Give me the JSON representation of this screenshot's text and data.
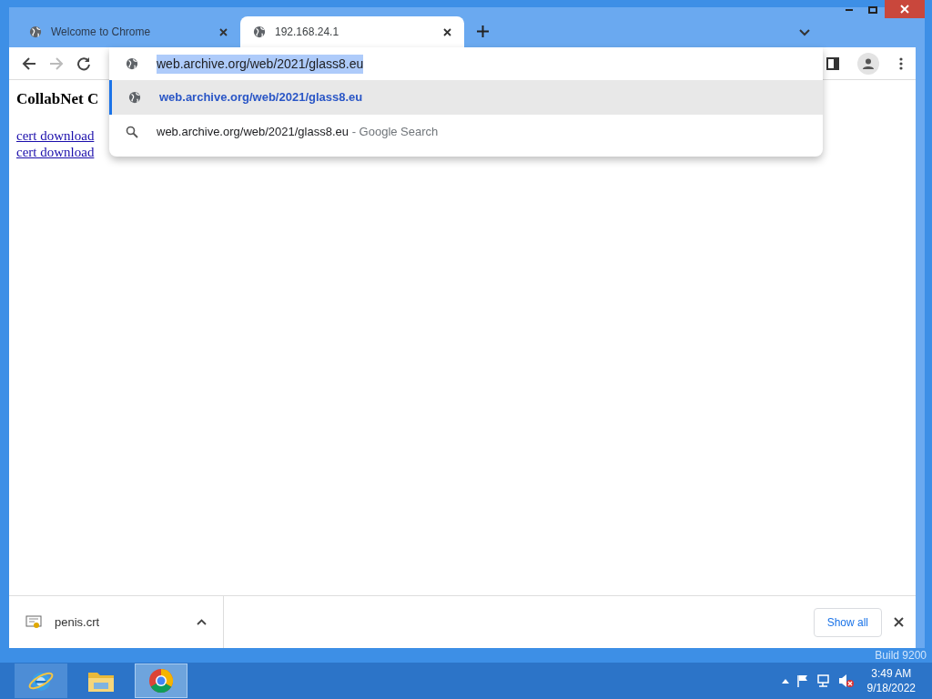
{
  "browser": {
    "tabs": [
      {
        "title": "Welcome to Chrome",
        "selected": false
      },
      {
        "title": "192.168.24.1",
        "selected": true
      }
    ],
    "omnibox": {
      "value": "web.archive.org/web/2021/glass8.eu",
      "highlighted": true
    },
    "suggestions": [
      {
        "kind": "url",
        "text": "web.archive.org/web/2021/glass8.eu",
        "selected": true
      },
      {
        "kind": "search",
        "text": "web.archive.org/web/2021/glass8.eu",
        "suffix": "- Google Search",
        "selected": false
      }
    ],
    "page": {
      "heading": "CollabNet C",
      "links": [
        "cert download",
        "cert download"
      ]
    },
    "download_bar": {
      "file": "penis.crt",
      "show_all": "Show all"
    }
  },
  "desktop": {
    "build": "Build 9200"
  },
  "taskbar": {
    "apps": [
      {
        "kind": "ie",
        "active": false
      },
      {
        "kind": "explorer",
        "active": false
      },
      {
        "kind": "chrome",
        "active": true
      }
    ],
    "time": "3:49 AM",
    "date": "9/18/2022"
  }
}
